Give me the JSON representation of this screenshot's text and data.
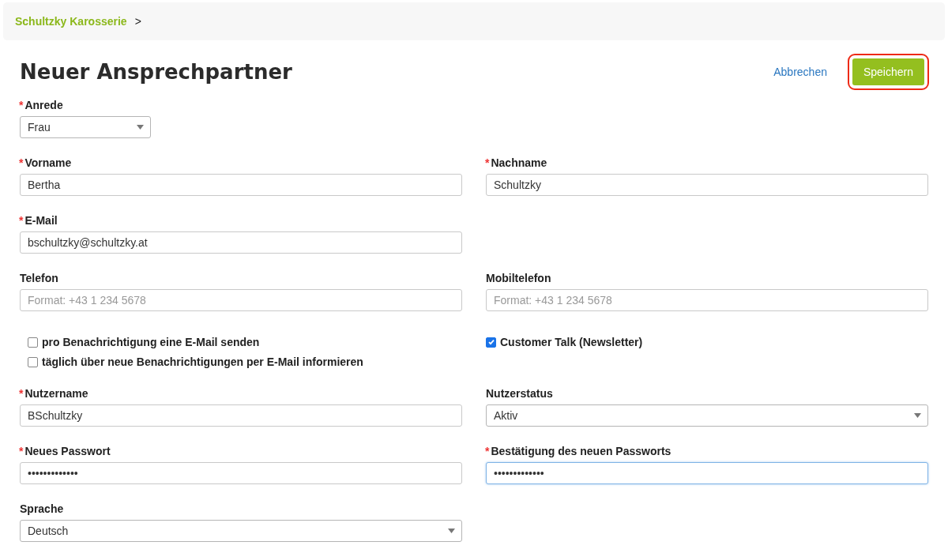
{
  "breadcrumb": {
    "link": "Schultzky Karosserie",
    "separator": ">"
  },
  "title": "Neuer Ansprechpartner",
  "actions": {
    "cancel": "Abbrechen",
    "save": {
      "label": "Speichern",
      "highlighted": true
    }
  },
  "rows": [
    {
      "left": {
        "kind": "short-select",
        "label": "Anrede",
        "required_mark": "*",
        "value": "Frau"
      }
    },
    {
      "left": {
        "kind": "input",
        "label": "Vorname",
        "required_mark": "*",
        "value": "Bertha"
      },
      "right": {
        "kind": "input",
        "label": "Nachname",
        "required_mark": "*",
        "value": "Schultzky"
      }
    },
    {
      "left": {
        "kind": "input",
        "label": "E-Mail",
        "required_mark": "*",
        "value": "bschultzky@schultzky.at"
      }
    },
    {
      "left": {
        "kind": "input",
        "label": "Telefon",
        "placeholder": "Format: +43 1 234 5678"
      },
      "right": {
        "kind": "input",
        "label": "Mobiltelefon",
        "placeholder": "Format: +43 1 234 5678"
      }
    },
    {
      "left": {
        "kind": "checks",
        "items": [
          {
            "label": "pro Benachrichtigung eine E-Mail senden",
            "checked": false
          },
          {
            "label": "täglich über neue Benachrichtigungen per E-Mail informieren",
            "checked": false
          }
        ]
      },
      "right": {
        "kind": "checks",
        "items": [
          {
            "label": "Customer Talk (Newsletter)",
            "checked": true
          }
        ]
      }
    },
    {
      "left": {
        "kind": "input",
        "label": "Nutzername",
        "required_mark": "*",
        "value": "BSchultzky"
      },
      "right": {
        "kind": "select",
        "label": "Nutzerstatus",
        "value": "Aktiv"
      }
    },
    {
      "left": {
        "kind": "input",
        "label": "Neues Passwort",
        "required_mark": "*",
        "value": "•••••••••••••"
      },
      "right": {
        "kind": "input",
        "label": "Bestätigung des neuen Passworts",
        "required_mark": "*",
        "value": "•••••••••••••",
        "focused": true
      }
    },
    {
      "left": {
        "kind": "select",
        "label": "Sprache",
        "value": "Deutsch"
      }
    }
  ]
}
